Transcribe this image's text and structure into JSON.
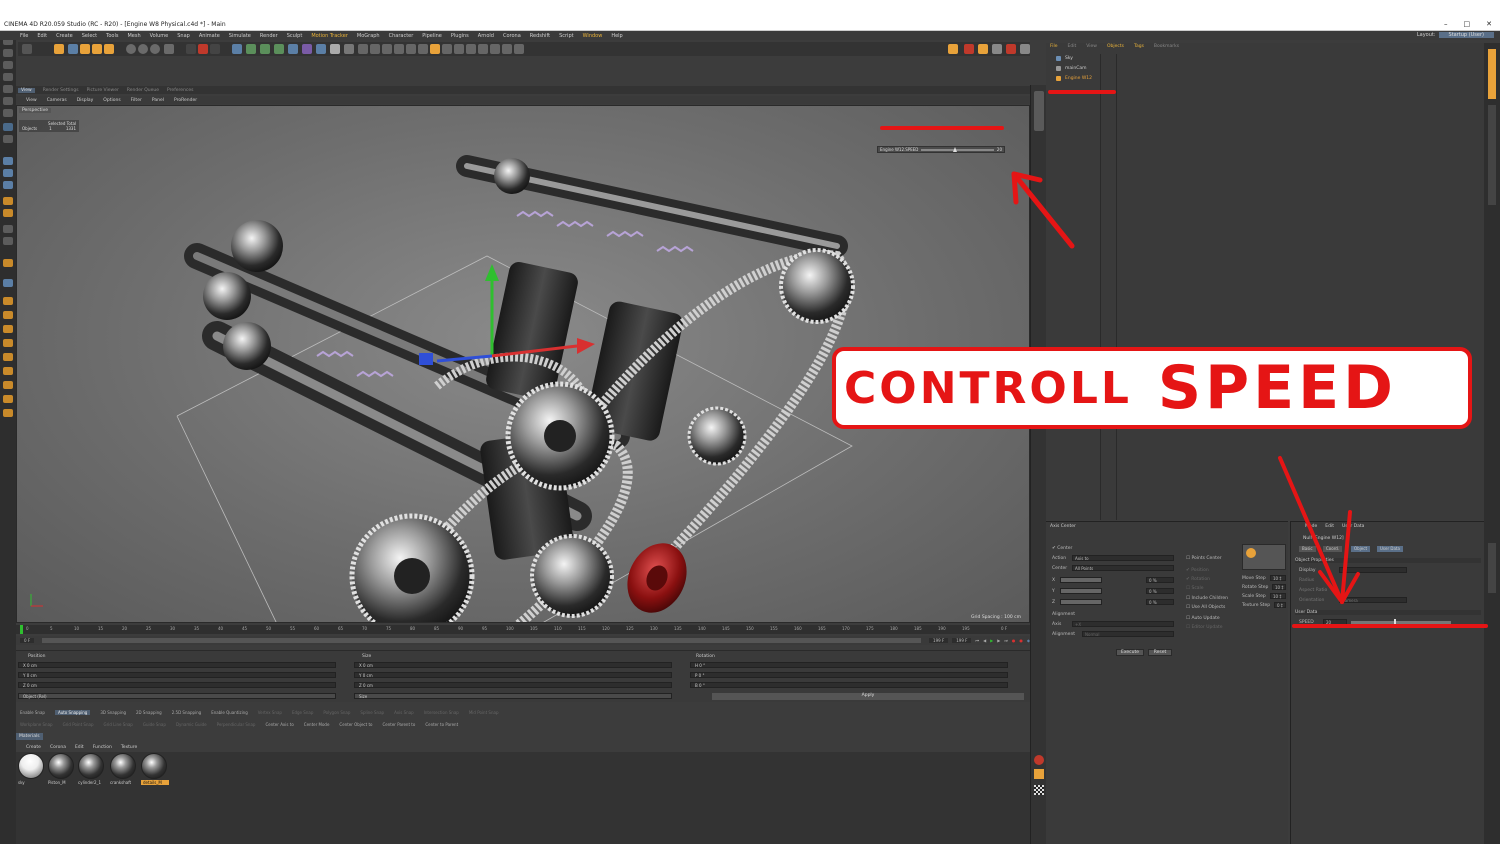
{
  "window": {
    "title": "CINEMA 4D R20.059 Studio (RC - R20) - [Engine W8 Physical.c4d *] - Main",
    "controls": [
      "–",
      "□",
      "✕"
    ]
  },
  "menubar": {
    "items": [
      "File",
      "Edit",
      "Create",
      "Select",
      "Tools",
      "Mesh",
      "Volume",
      "Snap",
      "Animate",
      "Simulate",
      "Render",
      "Sculpt",
      "Motion Tracker",
      "MoGraph",
      "Character",
      "Pipeline",
      "Plugins",
      "Arnold",
      "Corona",
      "Redshift",
      "Script",
      "Window",
      "Help"
    ],
    "layout_label": "Layout:",
    "layout_value": "Startup (User)"
  },
  "view_tabs": [
    "View",
    "Render Settings",
    "Picture Viewer",
    "Render Queue",
    "Preferences"
  ],
  "view_menu": [
    "View",
    "Cameras",
    "Display",
    "Options",
    "Filter",
    "Panel",
    "ProRender"
  ],
  "viewport": {
    "label": "Perspective",
    "hud_header": "Selected Total",
    "hud_row_label": "Objects",
    "hud_row_selected": "1",
    "hud_row_total": "1331",
    "speed_slider_label": "Engine W12.SPEED",
    "speed_slider_value": "20",
    "speed_fraction": 0.43,
    "grid_spacing": "Grid Spacing : 100 cm"
  },
  "callout": {
    "word1": "CONTROLL",
    "word2": "SPEED",
    "color": "#e51515"
  },
  "timeline": {
    "ticks": [
      "0",
      "5",
      "10",
      "15",
      "20",
      "25",
      "30",
      "35",
      "40",
      "45",
      "50",
      "55",
      "60",
      "65",
      "70",
      "75",
      "80",
      "85",
      "90",
      "95",
      "100",
      "105",
      "110",
      "115",
      "120",
      "125",
      "130",
      "135",
      "140",
      "145",
      "150",
      "155",
      "160",
      "165",
      "170",
      "175",
      "180",
      "185",
      "190",
      "195"
    ],
    "end_label": "0 F",
    "start_field": "0 F",
    "max_field": "199 F",
    "range_field": "199 F"
  },
  "coords": {
    "position_header": "Position",
    "size_header": "Size",
    "rotation_header": "Rotation",
    "position": [
      "X  0 cm",
      "Y  0 cm",
      "Z  0 cm"
    ],
    "size": [
      "X  0 cm",
      "Y  0 cm",
      "Z  0 cm"
    ],
    "rotation": [
      "H  0 °",
      "P  0 °",
      "B  0 °"
    ],
    "mode_left": "Object (Rel)",
    "mode_mid": "Size",
    "apply_label": "Apply"
  },
  "snap_bar": [
    "Enable Snap",
    "Auto Snapping",
    "3D Snapping",
    "2D Snapping",
    "2.5D Snapping",
    "Enable Quantizing",
    "Vertex Snap",
    "Edge Snap",
    "Polygon Snap",
    "Spline Snap",
    "Axis Snap",
    "Intersection Snap",
    "Mid Point Snap"
  ],
  "axis_bar": [
    "Workplane Snap",
    "Grid Point Snap",
    "Grid Line Snap",
    "Guide Snap",
    "Dynamic Guide",
    "Perpendicular Snap",
    "Center Axis to",
    "Center Mode",
    "Center Object to",
    "Center Parent to",
    "Center to Parent"
  ],
  "materials": {
    "tab_label": "Materials",
    "menu": [
      "Create",
      "Corona",
      "Edit",
      "Function",
      "Texture"
    ],
    "items": [
      {
        "label": "sky"
      },
      {
        "label": "Piston_M"
      },
      {
        "label": "cylinder2_1"
      },
      {
        "label": "crankshaft"
      },
      {
        "label": "details_M"
      }
    ]
  },
  "object_manager": {
    "menu": [
      "File",
      "Edit",
      "View",
      "Objects",
      "Tags",
      "Bookmarks"
    ],
    "objects": [
      {
        "name": "Sky"
      },
      {
        "name": "mainCam"
      },
      {
        "name": "Engine W12"
      }
    ]
  },
  "axis_center": {
    "title": "Axis Center",
    "center_label": "Center",
    "action_label": "Action",
    "action_value": "Axis to",
    "center_mode_label": "Center",
    "center_mode_value": "All Points",
    "axes": [
      {
        "label": "X",
        "value": "0 %"
      },
      {
        "label": "Y",
        "value": "0 %"
      },
      {
        "label": "Z",
        "value": "0 %"
      }
    ],
    "alignment_label": "Alignment",
    "axis_label": "Axis",
    "axis_value": "+X",
    "alignment_field_label": "Alignment",
    "alignment_value": "Normal",
    "points_center": "Points Center",
    "position": "Position",
    "rotation": "Rotation",
    "scale": "Scale",
    "include_children": "Include Children",
    "use_all_objects": "Use All Objects",
    "auto_update": "Auto Update",
    "editor_update": "Editor Update",
    "move_step_label": "Move Step",
    "move_step_value": "10 ‡",
    "rotate_step_label": "Rotate Step",
    "rotate_step_value": "10 ‡",
    "scale_step_label": "Scale Step",
    "scale_step_value": "10 ‡",
    "texture_step_label": "Texture Step",
    "texture_step_value": "0 ‡",
    "execute_label": "Execute",
    "reset_label": "Reset"
  },
  "attributes": {
    "menu": [
      "Mode",
      "Edit",
      "User Data"
    ],
    "object_title": "Null [Engine W12]",
    "tabs": [
      "Basic",
      "Coord.",
      "Object",
      "User Data"
    ],
    "object_props": "Object Properties",
    "display_label": "Display",
    "radius_label": "Radius",
    "aspect_label": "Aspect Ratio",
    "orientation_label": "Orientation",
    "orientation_value": "Camera",
    "user_data": "User Data",
    "speed_label": "SPEED",
    "speed_value": "20"
  }
}
